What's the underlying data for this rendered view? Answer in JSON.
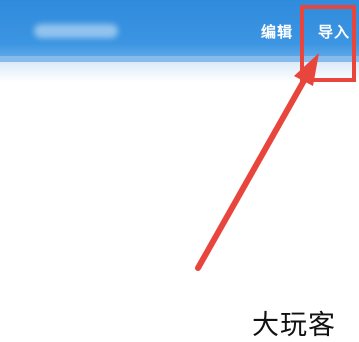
{
  "header": {
    "edit_label": "编辑",
    "import_label": "导入"
  },
  "annotation": {
    "color": "#e8453c"
  },
  "watermark": {
    "text": "大玩客"
  },
  "colors": {
    "header_blue": "#3c95e2",
    "text_white": "#ffffff"
  }
}
